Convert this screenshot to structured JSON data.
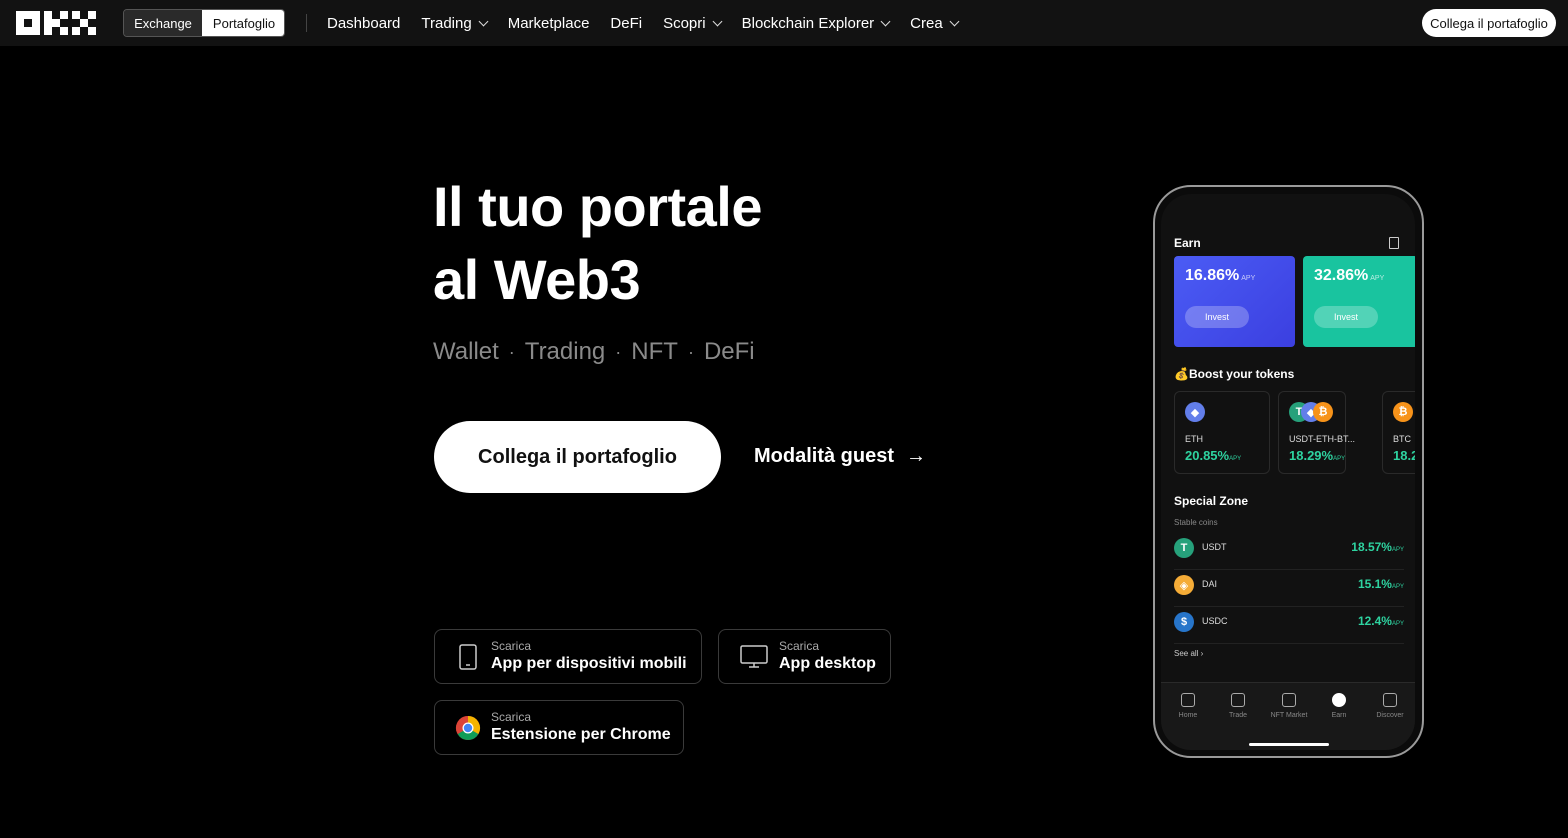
{
  "nav": {
    "segment": {
      "exchange": "Exchange",
      "portfolio": "Portafoglio"
    },
    "menu": [
      {
        "label": "Dashboard",
        "dropdown": false
      },
      {
        "label": "Trading",
        "dropdown": true
      },
      {
        "label": "Marketplace",
        "dropdown": false
      },
      {
        "label": "DeFi",
        "dropdown": false
      },
      {
        "label": "Scopri",
        "dropdown": true
      },
      {
        "label": "Blockchain Explorer",
        "dropdown": true
      },
      {
        "label": "Crea",
        "dropdown": true
      }
    ],
    "connect_label": "Collega il portafoglio"
  },
  "hero": {
    "title_line1": "Il tuo portale",
    "title_line2": "al Web3",
    "tagline": [
      "Wallet",
      "Trading",
      "NFT",
      "DeFi"
    ],
    "tagline_separator": "·",
    "cta_label": "Collega il portafoglio",
    "guest_label": "Modalità guest",
    "guest_arrow": "→"
  },
  "downloads": [
    {
      "small": "Scarica",
      "big": "App per dispositivi mobili",
      "icon": "mobile-phone-icon"
    },
    {
      "small": "Scarica",
      "big": "App desktop",
      "icon": "desktop-monitor-icon"
    },
    {
      "small": "Scarica",
      "big": "Estensione per Chrome",
      "icon": "chrome-icon"
    }
  ],
  "phone": {
    "earn_title": "Earn",
    "cards": [
      {
        "pct": "16.86%",
        "apy": "APY",
        "button": "Invest"
      },
      {
        "pct": "32.86%",
        "apy": "APY",
        "button": "Invest"
      }
    ],
    "boost_title": "💰Boost your tokens",
    "tokens": [
      {
        "name": "ETH",
        "apy": "20.85%",
        "apy_label": "APY"
      },
      {
        "name": "USDT-ETH-BT...",
        "apy": "18.29%",
        "apy_label": "APY"
      },
      {
        "name": "BTC",
        "apy": "18.2",
        "apy_label": ""
      }
    ],
    "special_title": "Special Zone",
    "special_sub": "Stable coins",
    "stable": [
      {
        "name": "USDT",
        "apy": "18.57%",
        "apy_label": "APY"
      },
      {
        "name": "DAI",
        "apy": "15.1%",
        "apy_label": "APY"
      },
      {
        "name": "USDC",
        "apy": "12.4%",
        "apy_label": "APY"
      }
    ],
    "see_all": "See all ›",
    "tabs": [
      "Home",
      "Trade",
      "NFT Market",
      "Earn",
      "Discover"
    ]
  },
  "colors": {
    "accent_green": "#2ed3a0",
    "card_blue": "#4b5cf5",
    "card_green": "#19c49f",
    "background": "#000000",
    "nav_background": "#121212"
  }
}
